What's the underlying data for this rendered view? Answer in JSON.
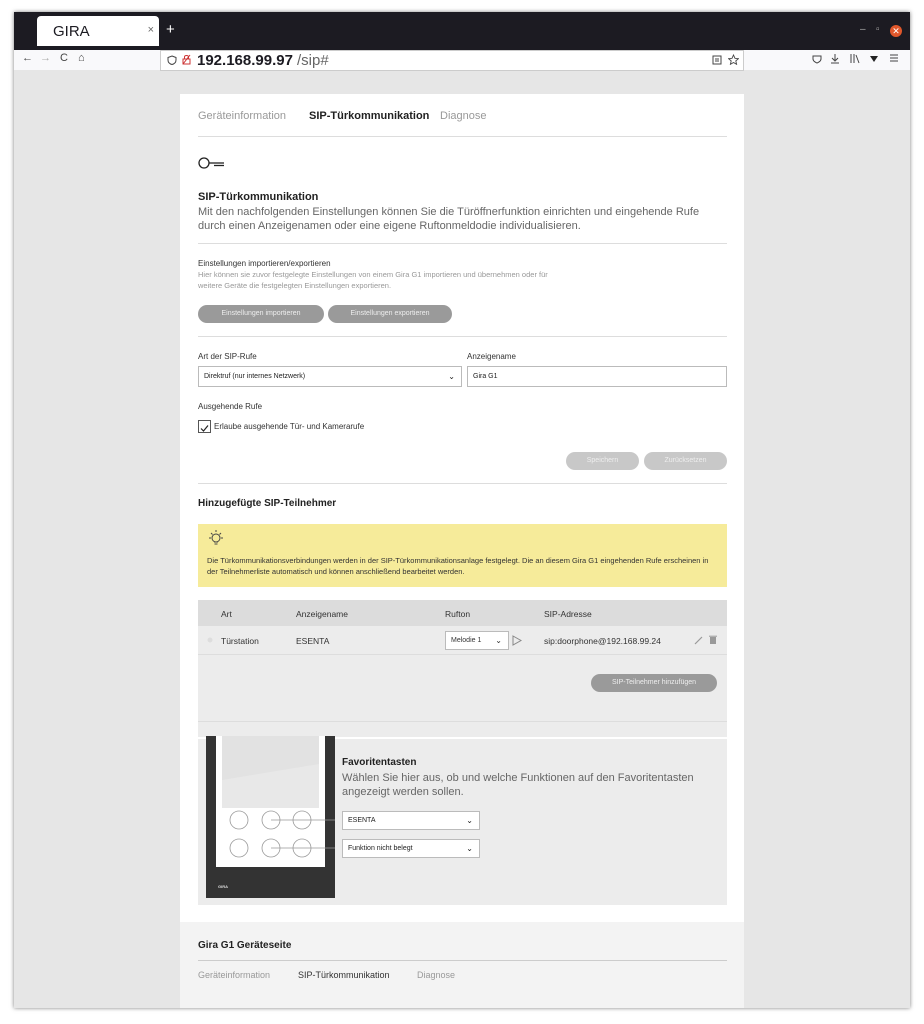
{
  "browser": {
    "tab_title": "GIRA",
    "tab_close": "×",
    "new_tab": "+",
    "url_host": "192.168.99.97",
    "url_path": "/sip#",
    "win_minimize": "–",
    "win_maximize": "▫",
    "win_close": "✕",
    "nav_back": "←",
    "nav_forward": "→",
    "nav_reload": "C",
    "nav_home": "⌂"
  },
  "tabs": [
    "Geräteinformation",
    "SIP-Türkommunikation",
    "Diagnose"
  ],
  "intro": {
    "title": "SIP-Türkommunikation",
    "text": "Mit den nachfolgenden Einstellungen können Sie die Türöffnerfunktion einrichten und eingehende Rufe durch einen Anzeigenamen oder eine eigene Ruftonmeldodie individualisieren."
  },
  "import_export": {
    "title": "Einstellungen importieren/exportieren",
    "text": "Hier können sie zuvor festgelegte Einstellungen von einem Gira G1 importieren und übernehmen oder für weitere Geräte die festgelegten Einstellungen exportieren.",
    "import_label": "Einstellungen importieren",
    "export_label": "Einstellungen exportieren"
  },
  "sip": {
    "call_type_label": "Art der SIP-Rufe",
    "call_type_value": "Direktruf (nur internes Netzwerk)",
    "display_name_label": "Anzeigename",
    "display_name_value": "Gira G1",
    "outgoing_label": "Ausgehende Rufe",
    "outgoing_checkbox_label": "Erlaube ausgehende Tür- und Kamerarufe",
    "save_label": "Speichern",
    "reset_label": "Zurücksetzen"
  },
  "participants": {
    "title": "Hinzugefügte SIP-Teilnehmer",
    "info": "Die Türkommunikationsverbindungen werden in der SIP-Türkommunikationsanlage festgelegt. Die an diesem Gira G1 eingehenden Rufe erscheinen in der Teilnehmerliste automatisch und können anschließend bearbeitet werden.",
    "columns": [
      "Art",
      "Anzeigename",
      "Rufton",
      "SIP-Adresse"
    ],
    "rows": [
      {
        "type": "Türstation",
        "name": "ESENTA",
        "ringtone": "Melodie 1",
        "address": "sip:doorphone@192.168.99.24"
      }
    ],
    "add_label": "SIP-Teilnehmer hinzufügen"
  },
  "favorites": {
    "title": "Favoritentasten",
    "text": "Wählen Sie hier aus, ob und welche Funktionen auf den Favoritentasten angezeigt werden sollen.",
    "select1": "ESENTA",
    "select2": "Funktion nicht belegt",
    "device_logo": "GIRA"
  },
  "footer": {
    "title": "Gira G1 Geräteseite",
    "links": [
      "Geräteinformation",
      "SIP-Türkommunikation",
      "Diagnose"
    ]
  }
}
